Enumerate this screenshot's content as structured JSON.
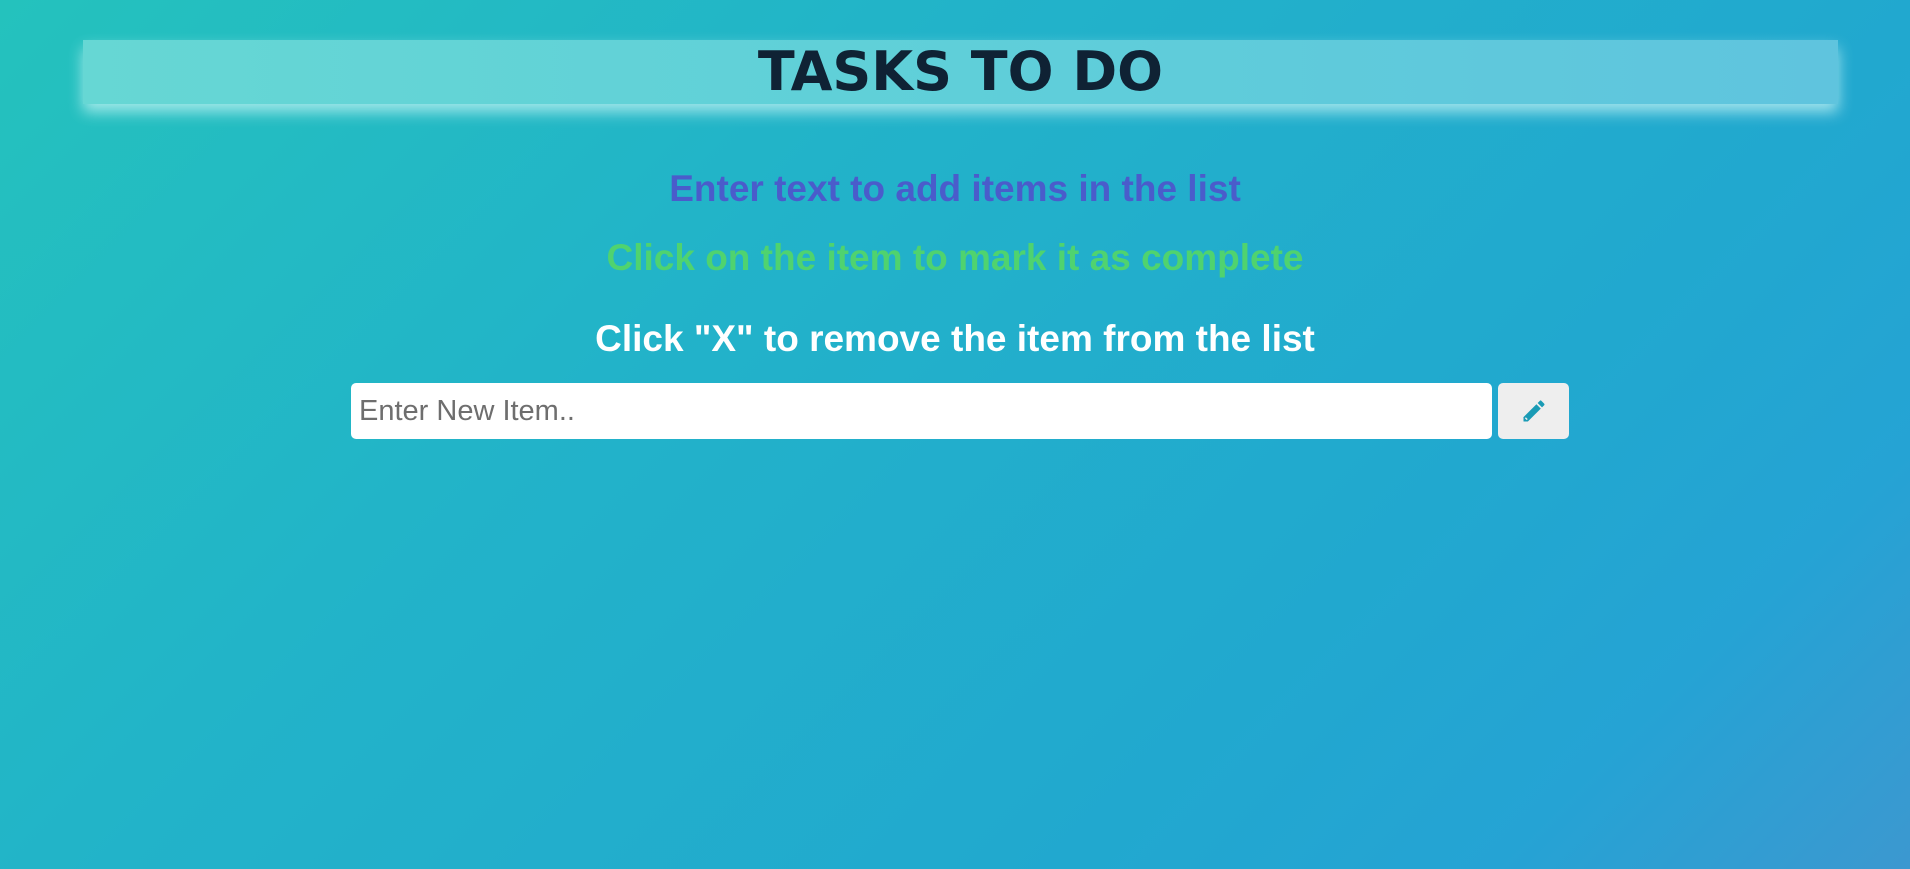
{
  "header": {
    "title": "TASKS TO DO"
  },
  "instructions": {
    "add": "Enter text to add items in the list",
    "complete": "Click on the item to mark it as complete",
    "remove": "Click \"X\" to remove the item from the list"
  },
  "new_item": {
    "value": "",
    "placeholder": "Enter New Item..",
    "add_icon": "pencil-icon"
  },
  "colors": {
    "title": "#0f2234",
    "add_instruction": "#4a5ccb",
    "complete_instruction": "#4fd36f",
    "remove_instruction": "#ffffff",
    "icon": "#1a9bb5"
  }
}
